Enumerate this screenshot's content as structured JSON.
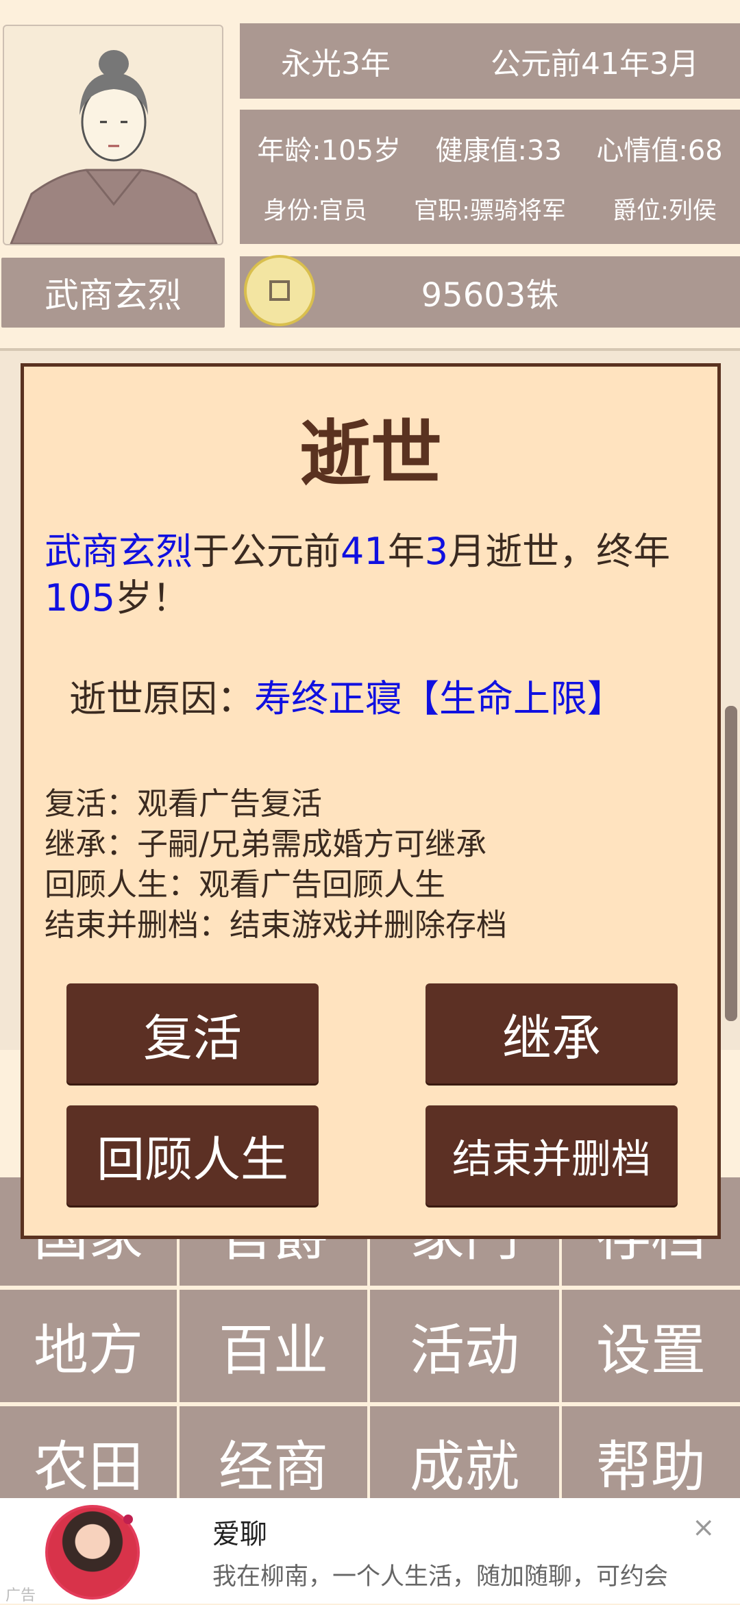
{
  "header": {
    "name": "武商玄烈",
    "era": "永光3年",
    "date": "公元前41年3月",
    "age": "年龄:105岁",
    "health": "健康值:33",
    "mood": "心情值:68",
    "identity": "身份:官员",
    "office": "官职:骠骑将军",
    "rank": "爵位:列侯",
    "money": "95603铢"
  },
  "menu": {
    "row1": [
      "国家",
      "官爵",
      "家门",
      "存档"
    ],
    "row2": [
      "地方",
      "百业",
      "活动",
      "设置"
    ],
    "row3": [
      "农田",
      "经商",
      "成就",
      "帮助"
    ]
  },
  "modal": {
    "title": "逝世",
    "msg_name": "武商玄烈",
    "msg_part1": "于公元前",
    "msg_year": "41",
    "msg_part2": "年",
    "msg_month": "3",
    "msg_part3": "月逝世，终年",
    "msg_age": "105",
    "msg_part4": "岁！",
    "reason_label": "逝世原因：",
    "reason_value": "寿终正寝【生命上限】",
    "help_lines": [
      "复活：观看广告复活",
      "继承：子嗣/兄弟需成婚方可继承",
      "回顾人生：观看广告回顾人生",
      "结束并删档：结束游戏并删除存档"
    ],
    "buttons": {
      "revive": "复活",
      "inherit": "继承",
      "review": "回顾人生",
      "end": "结束并删档"
    }
  },
  "ad": {
    "title": "爱聊",
    "text": "我在柳南，一个人生活，随加随聊，可约会",
    "tag": "广告",
    "close": "×"
  }
}
